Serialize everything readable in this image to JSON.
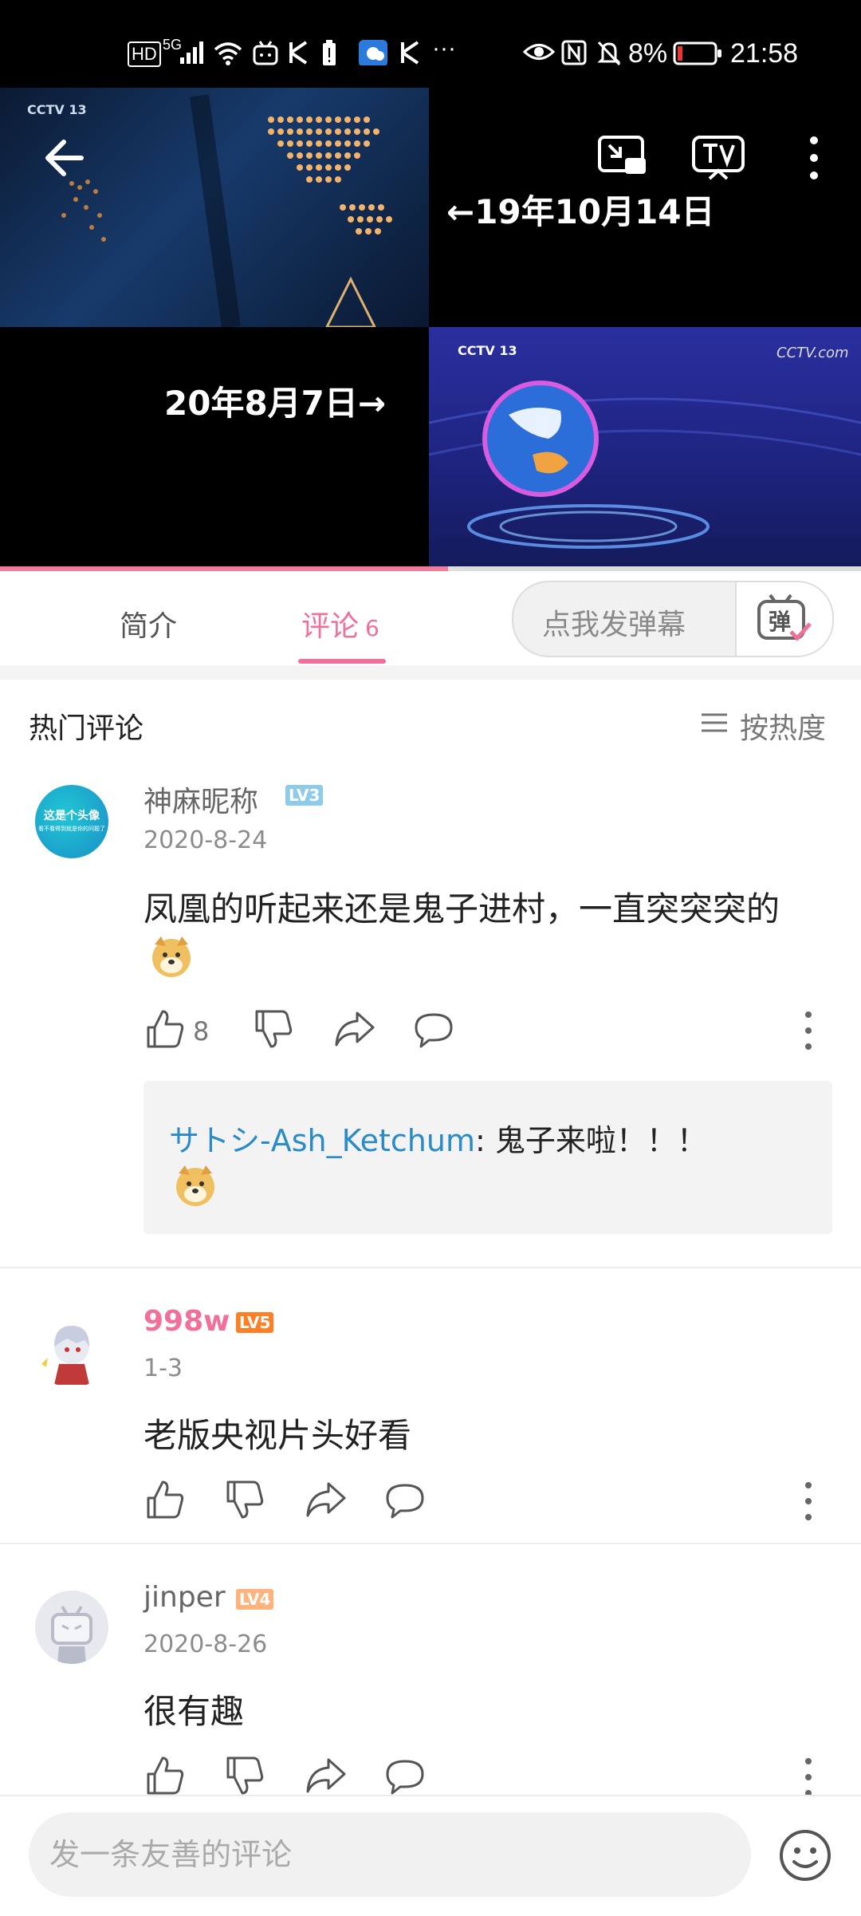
{
  "status_bar": {
    "left_icons": [
      "HD",
      "5G",
      "signal",
      "wifi",
      "bilibili",
      "kuaishou",
      "battery-saver",
      "weather",
      "kuaishou",
      "more"
    ],
    "hd_label": "HD",
    "net_label": "5G",
    "more_label": "···",
    "battery_percent": "8%",
    "time": "21:58"
  },
  "video": {
    "caption_top": "←19年10月14日",
    "caption_bottom": "20年8月7日→",
    "watermark_tl": "CCTV 13",
    "watermark_br": "CCTV 13",
    "watermark_brr": "CCTV.com",
    "progress": 0.52
  },
  "tabs": {
    "intro": "简介",
    "comments": "评论",
    "comments_count": "6",
    "danmaku_placeholder": "点我发弹幕",
    "danmaku_btn_label": "弹"
  },
  "comments_header": {
    "title": "热门评论",
    "sort_label": "按热度"
  },
  "comments": [
    {
      "username": "神麻昵称",
      "level": "LV3",
      "level_color": "#8ecbe8",
      "date": "2020-8-24",
      "text": "凤凰的听起来还是鬼子进村，一直突突突的",
      "likes": "8",
      "avatar_text_1": "这是个头像",
      "avatar_text_2": "看不看得到就是你的问题了",
      "reply": {
        "user": "サトシ-Ash_Ketchum",
        "separator": ":",
        "text": " 鬼子来啦！！！"
      }
    },
    {
      "username": "998w",
      "level": "LV5",
      "level_color": "#ff7f24",
      "date": "1-3",
      "text": "老版央视片头好看"
    },
    {
      "username": "jinper",
      "level": "LV4",
      "level_color": "#ffb37c",
      "date": "2020-8-26",
      "text": "很有趣"
    }
  ],
  "bottom_bar": {
    "input_placeholder": "发一条友善的评论"
  },
  "colors": {
    "accent": "#f0709a",
    "link": "#2b8bc6"
  }
}
